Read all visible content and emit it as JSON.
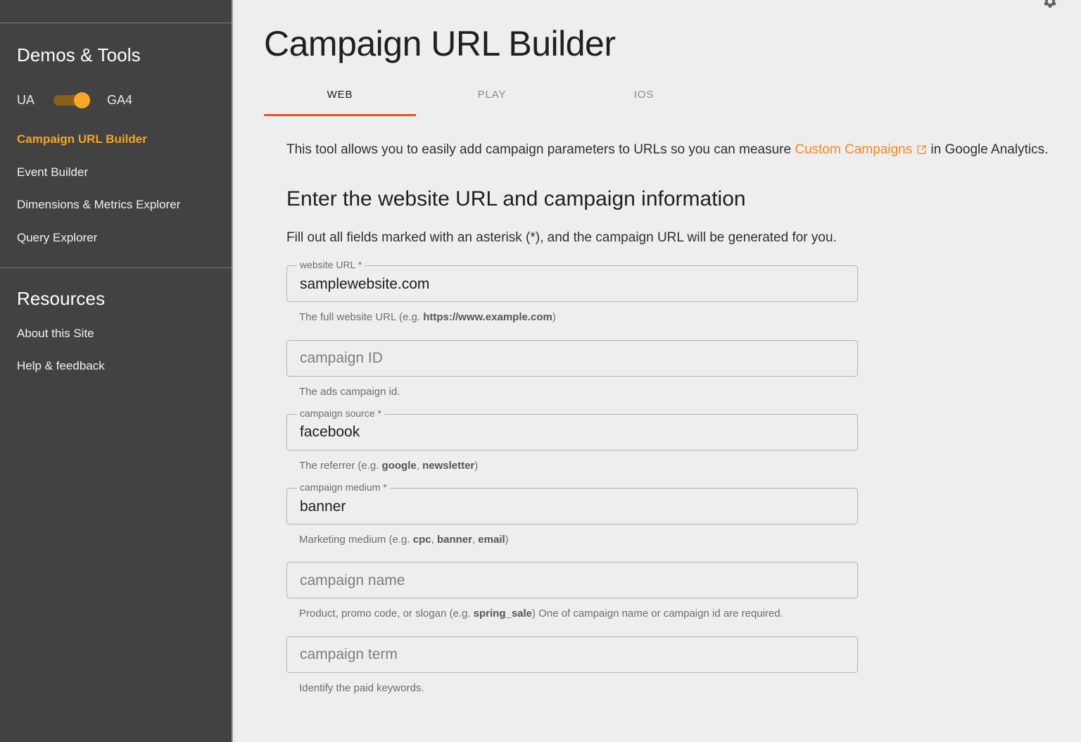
{
  "sidebar": {
    "sections": [
      {
        "heading": "Demos & Tools",
        "toggle": {
          "left_label": "UA",
          "right_label": "GA4",
          "state": "GA4",
          "active_color": "#f9a825"
        },
        "items": [
          {
            "label": "Campaign URL Builder",
            "active": true
          },
          {
            "label": "Event Builder",
            "active": false
          },
          {
            "label": "Dimensions & Metrics Explorer",
            "active": false
          },
          {
            "label": "Query Explorer",
            "active": false
          }
        ]
      },
      {
        "heading": "Resources",
        "items": [
          {
            "label": "About this Site",
            "active": false
          },
          {
            "label": "Help & feedback",
            "active": false
          }
        ]
      }
    ],
    "background_color": "#424242",
    "active_item_color": "#f5a623"
  },
  "header": {
    "title": "Campaign URL Builder",
    "gear_icon": "gear-icon"
  },
  "tabs": [
    {
      "label": "WEB",
      "active": true
    },
    {
      "label": "PLAY",
      "active": false
    },
    {
      "label": "IOS",
      "active": false
    }
  ],
  "tab_indicator_color": "#f4511e",
  "intro": {
    "before_link": "This tool allows you to easily add campaign parameters to URLs so you can measure ",
    "link_text": "Custom Campaigns",
    "link_icon": "open-in-new-icon",
    "after_link": " in Google Analytics.",
    "link_color": "#f5871f"
  },
  "section": {
    "heading": "Enter the website URL and campaign information",
    "instructions": "Fill out all fields marked with an asterisk (*), and the campaign URL will be generated for you."
  },
  "fields": [
    {
      "name": "website-url",
      "notch_label": "website URL *",
      "value": "samplewebsite.com",
      "placeholder": "",
      "filled": true,
      "helper_parts": [
        {
          "text": "The full website URL (e.g. ",
          "bold": false
        },
        {
          "text": "https://www.example.com",
          "bold": true
        },
        {
          "text": ")",
          "bold": false
        }
      ]
    },
    {
      "name": "campaign-id",
      "notch_label": "",
      "value": "",
      "placeholder": "campaign ID",
      "filled": false,
      "helper_parts": [
        {
          "text": "The ads campaign id.",
          "bold": false
        }
      ]
    },
    {
      "name": "campaign-source",
      "notch_label": "campaign source *",
      "value": "facebook",
      "placeholder": "",
      "filled": true,
      "helper_parts": [
        {
          "text": "The referrer (e.g. ",
          "bold": false
        },
        {
          "text": "google",
          "bold": true
        },
        {
          "text": ", ",
          "bold": false
        },
        {
          "text": "newsletter",
          "bold": true
        },
        {
          "text": ")",
          "bold": false
        }
      ]
    },
    {
      "name": "campaign-medium",
      "notch_label": "campaign medium *",
      "value": "banner",
      "placeholder": "",
      "filled": true,
      "helper_parts": [
        {
          "text": "Marketing medium (e.g. ",
          "bold": false
        },
        {
          "text": "cpc",
          "bold": true
        },
        {
          "text": ", ",
          "bold": false
        },
        {
          "text": "banner",
          "bold": true
        },
        {
          "text": ", ",
          "bold": false
        },
        {
          "text": "email",
          "bold": true
        },
        {
          "text": ")",
          "bold": false
        }
      ]
    },
    {
      "name": "campaign-name",
      "notch_label": "",
      "value": "",
      "placeholder": "campaign name",
      "filled": false,
      "helper_parts": [
        {
          "text": "Product, promo code, or slogan (e.g. ",
          "bold": false
        },
        {
          "text": "spring_sale",
          "bold": true
        },
        {
          "text": ") One of campaign name or campaign id are required.",
          "bold": false
        }
      ]
    },
    {
      "name": "campaign-term",
      "notch_label": "",
      "value": "",
      "placeholder": "campaign term",
      "filled": false,
      "helper_parts": [
        {
          "text": "Identify the paid keywords.",
          "bold": false
        }
      ]
    }
  ]
}
